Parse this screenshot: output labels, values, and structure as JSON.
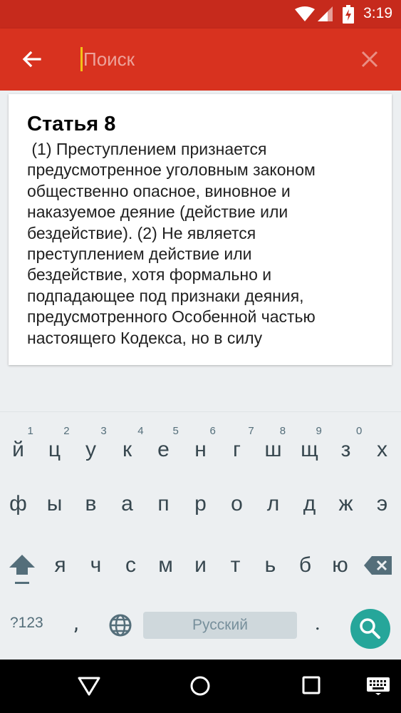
{
  "status_bar": {
    "time": "3:19"
  },
  "app_bar": {
    "search_placeholder": "Поиск"
  },
  "article": {
    "title": "Статья 8",
    "body": " (1) Преступлением признается\nпредусмотренное уголовным законом\nобщественно опасное, виновное и\nнаказуемое деяние (действие или\nбездействие). (2) Не является\nпреступлением действие или\nбездействие, хотя формально и\nподпадающее под признаки деяния,\nпредусмотренного Особенной частью\nнастоящего Кодекса, но в силу"
  },
  "keyboard": {
    "row1": [
      {
        "hint": "1",
        "ch": "й"
      },
      {
        "hint": "2",
        "ch": "ц"
      },
      {
        "hint": "3",
        "ch": "у"
      },
      {
        "hint": "4",
        "ch": "к"
      },
      {
        "hint": "5",
        "ch": "е"
      },
      {
        "hint": "6",
        "ch": "н"
      },
      {
        "hint": "7",
        "ch": "г"
      },
      {
        "hint": "8",
        "ch": "ш"
      },
      {
        "hint": "9",
        "ch": "щ"
      },
      {
        "hint": "0",
        "ch": "з"
      },
      {
        "hint": "",
        "ch": "х"
      }
    ],
    "row2": [
      "ф",
      "ы",
      "в",
      "а",
      "п",
      "р",
      "о",
      "л",
      "д",
      "ж",
      "э"
    ],
    "row3": [
      "я",
      "ч",
      "с",
      "м",
      "и",
      "т",
      "ь",
      "б",
      "ю"
    ],
    "symbols_label": "?123",
    "comma": ",",
    "space_label": "Русский",
    "period": ".",
    "accent_color": "#26a69a"
  },
  "colors": {
    "status_bar": "#c62a1c",
    "app_bar": "#d8321f",
    "cursor": "#f3c317"
  }
}
